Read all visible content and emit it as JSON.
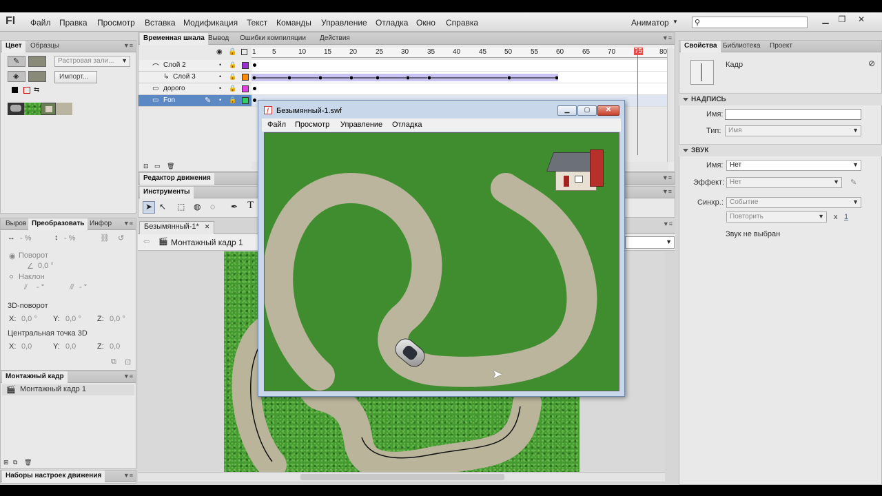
{
  "app": {
    "logo": "Fl",
    "menu": [
      "Файл",
      "Правка",
      "Просмотр",
      "Вставка",
      "Модификация",
      "Текст",
      "Команды",
      "Управление",
      "Отладка",
      "Окно",
      "Справка"
    ],
    "workspace": "Аниматор"
  },
  "left": {
    "color_tabs": [
      "Цвет",
      "Образцы"
    ],
    "fill_type": "Растровая зали...",
    "import_button": "Импорт...",
    "transform_tabs": [
      "Выров",
      "Преобразовать",
      "Инфор"
    ],
    "width_pct": "- %",
    "height_pct": "- %",
    "rotate_label": "Поворот",
    "rotate_value": "0,0 °",
    "skew_label": "Наклон",
    "skew_x": "- °",
    "skew_y": "- °",
    "rotation3d_label": "3D-поворот",
    "rot_x_label": "X:",
    "rot_x": "0,0 °",
    "rot_y_label": "Y:",
    "rot_y": "0,0 °",
    "rot_z_label": "Z:",
    "rot_z": "0,0 °",
    "center3d_label": "Центральная точка 3D",
    "c_x_label": "X:",
    "c_x": "0,0",
    "c_y_label": "Y:",
    "c_y": "0,0",
    "c_z_label": "Z:",
    "c_z": "0,0",
    "scene_panel_title": "Монтажный кадр",
    "scene_item": "Монтажный кадр 1",
    "presets_title": "Наборы настроек движения"
  },
  "timeline": {
    "tabs": [
      "Временная шкала",
      "Вывод",
      "Ошибки компиляции",
      "Действия"
    ],
    "frame_numbers": [
      "1",
      "5",
      "10",
      "15",
      "20",
      "25",
      "30",
      "35",
      "40",
      "45",
      "50",
      "55",
      "60",
      "65",
      "70",
      "75",
      "80"
    ],
    "layers": [
      {
        "name": "Слой 2",
        "color": "#9b30d0"
      },
      {
        "name": "Слой 3",
        "color": "#ff8a00"
      },
      {
        "name": "дорого",
        "color": "#e040e0"
      },
      {
        "name": "Fon",
        "color": "#30d060"
      }
    ],
    "motion_editor": "Редактор движения",
    "tools_title": "Инструменты"
  },
  "document": {
    "tab": "Безымянный-1*",
    "scene": "Монтажный кадр 1"
  },
  "swf_window": {
    "title": "Безымянный-1.swf",
    "menu": [
      "Файл",
      "Просмотр",
      "Управление",
      "Отладка"
    ]
  },
  "right": {
    "tabs": [
      "Свойства",
      "Библиотека",
      "Проект"
    ],
    "frame_label": "Кадр",
    "section_label": "НАДПИСЬ",
    "name_label": "Имя:",
    "type_label": "Тип:",
    "type_value": "Имя",
    "sound_section": "ЗВУК",
    "sound_name_label": "Имя:",
    "sound_name_value": "Нет",
    "effect_label": "Эффект:",
    "effect_value": "Нет",
    "sync_label": "Синхр.:",
    "sync_value": "Событие",
    "repeat_value": "Повторить",
    "repeat_x": "x",
    "repeat_count": "1",
    "no_sound": "Звук не выбран"
  }
}
